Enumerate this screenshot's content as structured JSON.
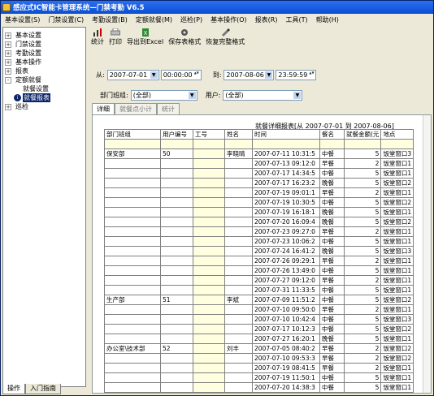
{
  "window": {
    "title": "感应式IC智能卡管理系统—门禁考勤 V6.5"
  },
  "menu": [
    "基本设置(S)",
    "门禁设置(C)",
    "考勤设置(B)",
    "定额就餐(M)",
    "巡检(P)",
    "基本操作(O)",
    "报表(R)",
    "工具(T)",
    "帮助(H)"
  ],
  "tree": [
    {
      "label": "基本设置",
      "pm": "+"
    },
    {
      "label": "门禁设置",
      "pm": "+"
    },
    {
      "label": "考勤设置",
      "pm": "+"
    },
    {
      "label": "基本操作",
      "pm": "+"
    },
    {
      "label": "报表",
      "pm": "+"
    },
    {
      "label": "定额就餐",
      "pm": "-"
    },
    {
      "label": "就餐设置",
      "child": true
    },
    {
      "label": "就餐报表",
      "child": true,
      "selected": true
    },
    {
      "label": "巡检",
      "pm": "+"
    }
  ],
  "left_tabs": [
    "操作",
    "入门指南"
  ],
  "toolbar": [
    "统计",
    "打印",
    "导出到Excel",
    "保存表格式",
    "恢复完整格式"
  ],
  "filter": {
    "from_label": "从:",
    "from_date": "2007-07-01",
    "from_time": "00:00:00",
    "to_label": "到:",
    "to_date": "2007-08-06",
    "to_time": "23:59:59",
    "dept_label": "部门班组:",
    "dept_value": "(全部)",
    "user_label": "用户:",
    "user_value": "(全部)"
  },
  "tabs": [
    "详细",
    "就餐点小计",
    "统计"
  ],
  "report": {
    "title": "就餐详细报表[从 2007-07-01 到 2007-08-06]",
    "headers": [
      "部门班组",
      "用户编号",
      "工号",
      "姓名",
      "时间",
      "餐名",
      "就餐金额(元",
      "地点"
    ],
    "rows": [
      {
        "dept": "保安部",
        "uid": "50",
        "name": "李晓晴",
        "time": "2007-07-11 10:31:5",
        "meal": "中餐",
        "amt": "5",
        "loc": "饭堂窗口3"
      },
      {
        "time": "2007-07-13 09:12:0",
        "meal": "早餐",
        "amt": "2",
        "loc": "饭堂窗口1"
      },
      {
        "time": "2007-07-17 14:34:5",
        "meal": "中餐",
        "amt": "5",
        "loc": "饭堂窗口1"
      },
      {
        "time": "2007-07-17 16:23:2",
        "meal": "晚餐",
        "amt": "5",
        "loc": "饭堂窗口2"
      },
      {
        "time": "2007-07-19 09:01:1",
        "meal": "早餐",
        "amt": "2",
        "loc": "饭堂窗口1"
      },
      {
        "time": "2007-07-19 10:30:5",
        "meal": "中餐",
        "amt": "5",
        "loc": "饭堂窗口2"
      },
      {
        "time": "2007-07-19 16:18:1",
        "meal": "晚餐",
        "amt": "5",
        "loc": "饭堂窗口1"
      },
      {
        "time": "2007-07-20 16:09:4",
        "meal": "晚餐",
        "amt": "5",
        "loc": "饭堂窗口2"
      },
      {
        "time": "2007-07-23 09:27:0",
        "meal": "早餐",
        "amt": "2",
        "loc": "饭堂窗口1"
      },
      {
        "time": "2007-07-23 10:06:2",
        "meal": "中餐",
        "amt": "5",
        "loc": "饭堂窗口1"
      },
      {
        "time": "2007-07-24 16:41:2",
        "meal": "晚餐",
        "amt": "5",
        "loc": "饭堂窗口3"
      },
      {
        "time": "2007-07-26 09:29:1",
        "meal": "早餐",
        "amt": "2",
        "loc": "饭堂窗口1"
      },
      {
        "time": "2007-07-26 13:49:0",
        "meal": "中餐",
        "amt": "5",
        "loc": "饭堂窗口1"
      },
      {
        "time": "2007-07-27 09:12:0",
        "meal": "早餐",
        "amt": "2",
        "loc": "饭堂窗口1"
      },
      {
        "time": "2007-07-31 11:33:5",
        "meal": "中餐",
        "amt": "5",
        "loc": "饭堂窗口1"
      },
      {
        "dept": "生产部",
        "uid": "51",
        "name": "李斌",
        "time": "2007-07-09 11:51:2",
        "meal": "中餐",
        "amt": "5",
        "loc": "饭堂窗口2"
      },
      {
        "time": "2007-07-10 09:50:0",
        "meal": "早餐",
        "amt": "2",
        "loc": "饭堂窗口1"
      },
      {
        "time": "2007-07-10 10:42:4",
        "meal": "中餐",
        "amt": "5",
        "loc": "饭堂窗口3"
      },
      {
        "time": "2007-07-17 10:12:3",
        "meal": "中餐",
        "amt": "5",
        "loc": "饭堂窗口2"
      },
      {
        "time": "2007-07-27 16:20:1",
        "meal": "晚餐",
        "amt": "5",
        "loc": "饭堂窗口1"
      },
      {
        "dept": "办公室\\技术部",
        "uid": "52",
        "name": "刘丰",
        "time": "2007-07-05 08:40:2",
        "meal": "早餐",
        "amt": "2",
        "loc": "饭堂窗口2"
      },
      {
        "time": "2007-07-10 09:53:3",
        "meal": "早餐",
        "amt": "2",
        "loc": "饭堂窗口2"
      },
      {
        "time": "2007-07-19 08:41:5",
        "meal": "早餐",
        "amt": "2",
        "loc": "饭堂窗口1"
      },
      {
        "time": "2007-07-19 11:50:1",
        "meal": "中餐",
        "amt": "5",
        "loc": "饭堂窗口1"
      },
      {
        "time": "2007-07-20 14:38:3",
        "meal": "中餐",
        "amt": "5",
        "loc": "饭堂窗口1"
      }
    ]
  }
}
